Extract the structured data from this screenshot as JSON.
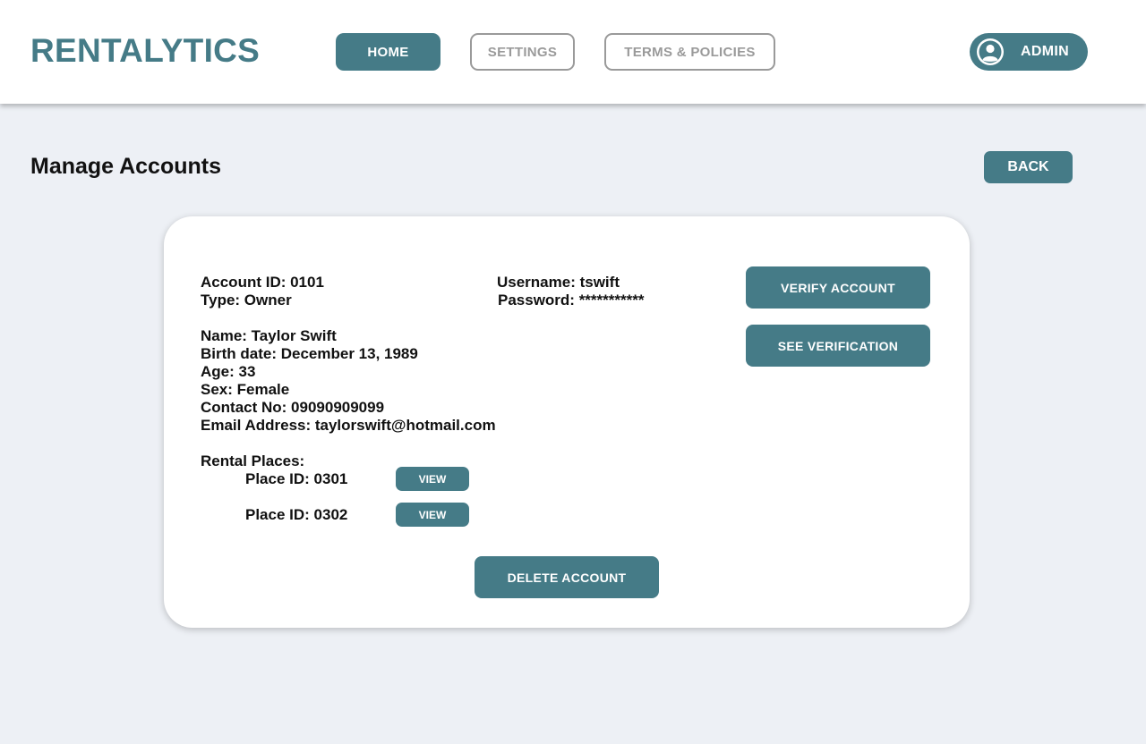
{
  "header": {
    "logo": "RENTALYTICS",
    "nav": {
      "home": "HOME",
      "settings": "SETTINGS",
      "terms": "TERMS & POLICIES"
    },
    "user": {
      "label": "ADMIN",
      "icon": "user-circle-icon"
    }
  },
  "page": {
    "title": "Manage Accounts",
    "back_label": "BACK"
  },
  "account": {
    "account_id": "Account ID: 0101",
    "type": "Type: Owner",
    "username": "Username: tswift",
    "password": "Password: ***********",
    "name": "Name: Taylor Swift",
    "birth_date": "Birth date: December 13, 1989",
    "age": "Age: 33",
    "sex": "Sex: Female",
    "contact": "Contact No: 09090909099",
    "email": "Email Address: taylorswift@hotmail.com",
    "rental_places_label": "Rental Places:",
    "places": [
      {
        "label": "Place ID: 0301",
        "view_label": "VIEW"
      },
      {
        "label": "Place ID: 0302",
        "view_label": "VIEW"
      }
    ]
  },
  "actions": {
    "verify": "VERIFY ACCOUNT",
    "see_verification": "SEE VERIFICATION",
    "delete": "DELETE ACCOUNT"
  },
  "colors": {
    "accent": "#457b87",
    "background": "#edf0f5",
    "muted": "#9a9a9a"
  }
}
